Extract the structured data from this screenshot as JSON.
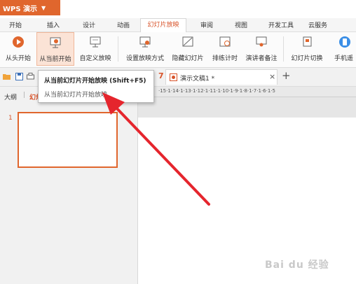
{
  "titlebar": {
    "app": "WPS 演示"
  },
  "menu": [
    "开始",
    "插入",
    "设计",
    "动画",
    "幻灯片放映",
    "审阅",
    "视图",
    "开发工具",
    "云服务"
  ],
  "ribbon": {
    "from_start": "从头开始",
    "from_current": "从当前开始",
    "custom_show": "自定义放映",
    "setup_show": "设置放映方式",
    "hide_slide": "隐藏幻灯片",
    "rehearse": "排练计时",
    "speaker_notes": "演讲者备注",
    "slide_switch": "幻灯片切换",
    "phone": "手机遥"
  },
  "tabs": {
    "doc": "演示文稿1 *",
    "close": "×",
    "new": "+",
    "num": "7"
  },
  "panel": {
    "outline": "大纲",
    "slides": "幻灯片",
    "slide_number": "1"
  },
  "ruler": "·15·1·14·1·13·1·12·1·11·1·10·1·9·1·8·1·7·1·6·1·5",
  "tooltip": {
    "title": "从当前幻灯片开始放映 (Shift+F5)",
    "desc": "从当前幻灯片开始放映。"
  },
  "watermark": "Bai du 经验",
  "colors": {
    "accent": "#e0662d",
    "arrow": "#e5252d"
  }
}
